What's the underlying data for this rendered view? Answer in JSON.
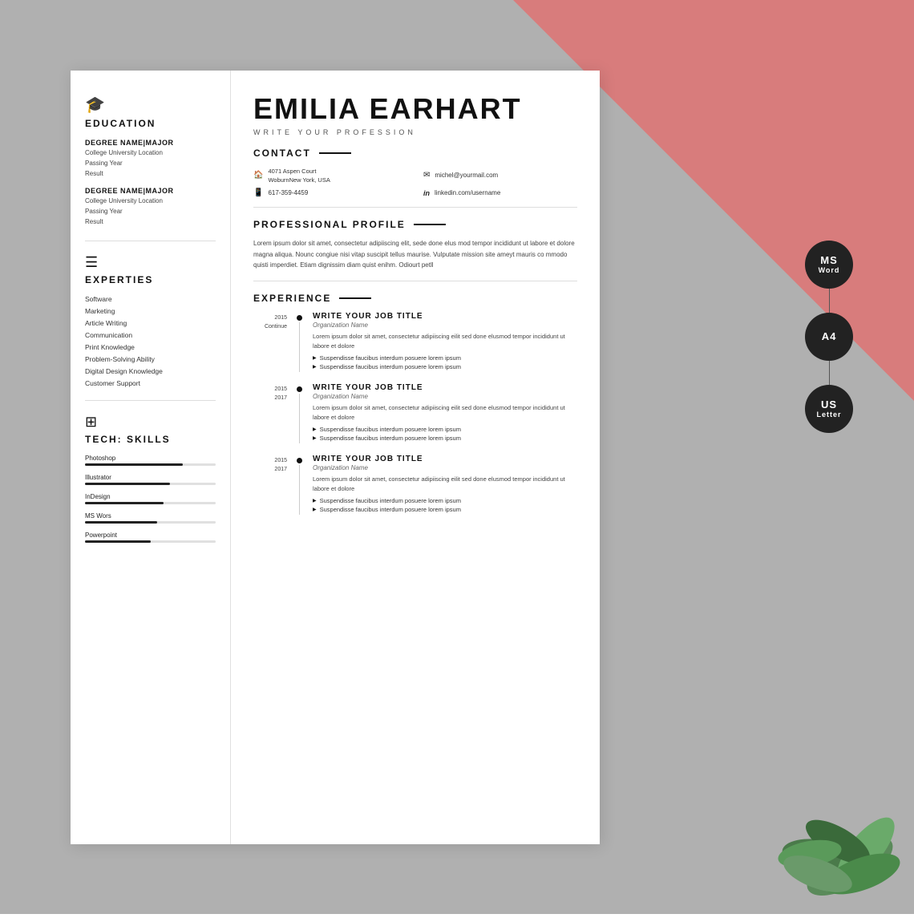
{
  "background": {
    "main_color": "#b2b2b2",
    "accent_color": "#d87c7c"
  },
  "resume": {
    "name": "EMILIA EARHART",
    "profession": "WRITE YOUR PROFESSION",
    "sidebar": {
      "education": {
        "section_title": "EDUCATION",
        "degrees": [
          {
            "name": "DEGREE NAME|MAJOR",
            "university": "College University Location",
            "year": "Passing Year",
            "result": "Result"
          },
          {
            "name": "DEGREE NAME|MAJOR",
            "university": "College University Location",
            "year": "Passing Year",
            "result": "Result"
          }
        ]
      },
      "experties": {
        "section_title": "EXPERTIES",
        "items": [
          "Software",
          "Marketing",
          "Article Writing",
          "Communication",
          "Print Knowledge",
          "Problem-Solving Ability",
          "Digital Design Knowledge",
          "Customer Support"
        ]
      },
      "tech_skills": {
        "section_title": "TECH: SKILLS",
        "skills": [
          {
            "label": "Photoshop",
            "percent": 75
          },
          {
            "label": "Illustrator",
            "percent": 65
          },
          {
            "label": "InDesign",
            "percent": 60
          },
          {
            "label": "MS Wors",
            "percent": 55
          },
          {
            "label": "Powerpoint",
            "percent": 50
          }
        ]
      }
    },
    "contact": {
      "section_title": "CONTACT",
      "address": "4071 Aspen Court\nWoburnNew York, USA",
      "phone": "617-359-4459",
      "email": "michel@yourmail.com",
      "linkedin": "linkedin.com/username"
    },
    "profile": {
      "section_title": "PROFESSIONAL PROFILE",
      "text": "Lorem ipsum dolor sit amet, consectetur adipiiscing elit, sede done elus mod tempor incididunt ut labore et dolore magna aliqua. Nounc congiue nisi vitap suscipit tellus maurise. Vulputate mission site ameyt mauris co mmodo quisti imperdiet. Etiam dignissim diam quist enihm. Odiourt petll"
    },
    "experience": {
      "section_title": "EXPERIENCE",
      "entries": [
        {
          "year_start": "2015",
          "year_end": "Continue",
          "job_title": "WRITE YOUR JOB TITLE",
          "org": "Organization Name",
          "desc": "Lorem ipsum dolor sit amet, consectetur adipiiscing eilit sed done elusmod tempor incididunt ut labore et dolore",
          "bullets": [
            "Suspendisse faucibus interdum posuere lorem ipsum",
            "Suspendisse faucibus interdum posuere lorem ipsum"
          ]
        },
        {
          "year_start": "2015",
          "year_end": "2017",
          "job_title": "WRITE YOUR JOB TITLE",
          "org": "Organization Name",
          "desc": "Lorem ipsum dolor sit amet, consectetur adipiiscing eilit sed done elusmod tempor incididunt ut labore et dolore",
          "bullets": [
            "Suspendisse faucibus interdum posuere lorem ipsum",
            "Suspendisse faucibus interdum posuere lorem ipsum"
          ]
        },
        {
          "year_start": "2015",
          "year_end": "2017",
          "job_title": "WRITE YOUR JOB TITLE",
          "org": "Organization Name",
          "desc": "Lorem ipsum dolor sit amet, consectetur adipiiscing eilit sed done elusmod tempor incididunt ut labore et dolore",
          "bullets": [
            "Suspendisse faucibus interdum posuere lorem ipsum",
            "Suspendisse faucibus interdum posuere lorem ipsum"
          ]
        }
      ]
    }
  },
  "badges": [
    {
      "main": "MS",
      "sub": "Word"
    },
    {
      "main": "A4",
      "sub": ""
    },
    {
      "main": "US",
      "sub": "Letter"
    }
  ]
}
